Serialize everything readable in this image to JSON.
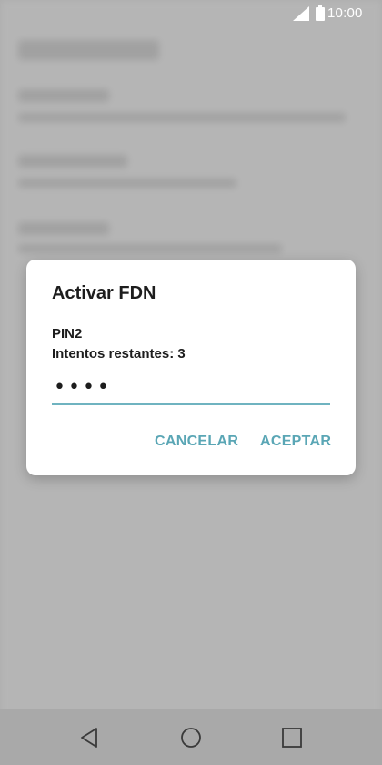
{
  "status_bar": {
    "time": "10:00",
    "icons": [
      "signal-icon",
      "battery-icon"
    ]
  },
  "dialog": {
    "title": "Activar FDN",
    "line_1": "PIN2",
    "line_2": "Intentos restantes: 3",
    "pin_value": "••••",
    "cancel_label": "CANCELAR",
    "ok_label": "ACEPTAR",
    "accent_color": "#5aa6b5"
  },
  "nav_bar": {
    "icons": [
      "back-icon",
      "home-icon",
      "recent-apps-icon"
    ]
  }
}
